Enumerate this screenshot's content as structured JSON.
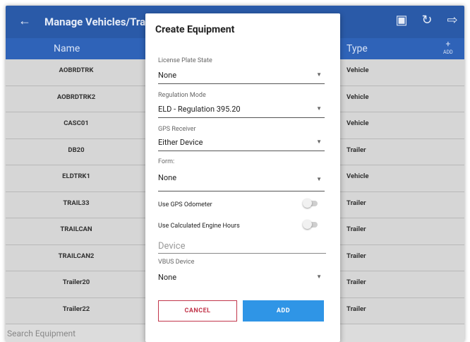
{
  "appbar": {
    "title": "Manage Vehicles/Trailers",
    "icons": [
      "back-arrow-icon",
      "report-icon",
      "refresh-icon",
      "exit-icon"
    ]
  },
  "table": {
    "col_name": "Name",
    "col_type": "Type",
    "add_label": "ADD",
    "rows": [
      {
        "name": "AOBRDTRK",
        "type": "Vehicle"
      },
      {
        "name": "AOBRDTRK2",
        "type": "Vehicle"
      },
      {
        "name": "CASC01",
        "type": "Vehicle"
      },
      {
        "name": "DB20",
        "type": "Trailer"
      },
      {
        "name": "ELDTRK1",
        "type": "Vehicle"
      },
      {
        "name": "TRAIL33",
        "type": "Trailer"
      },
      {
        "name": "TRAILCAN",
        "type": "Trailer"
      },
      {
        "name": "TRAILCAN2",
        "type": "Trailer"
      },
      {
        "name": "Trailer20",
        "type": "Trailer"
      },
      {
        "name": "Trailer22",
        "type": "Trailer"
      }
    ]
  },
  "search_placeholder": "Search Equipment",
  "dialog": {
    "title": "Create Equipment",
    "license_plate_state_label": "License Plate State",
    "license_plate_state_value": "None",
    "regulation_mode_label": "Regulation Mode",
    "regulation_mode_value": "ELD - Regulation 395.20",
    "gps_receiver_label": "GPS Receiver",
    "gps_receiver_value": "Either Device",
    "form_label": "Form:",
    "form_value": "None",
    "use_gps_odometer_label": "Use GPS Odometer",
    "use_gps_odometer_on": false,
    "use_calc_engine_hours_label": "Use Calculated Engine Hours",
    "use_calc_engine_hours_on": false,
    "device_placeholder": "Device",
    "vbus_device_label": "VBUS Device",
    "vbus_device_value": "None",
    "cancel_label": "CANCEL",
    "add_label": "ADD"
  },
  "colors": {
    "appbar": "#2a5aa8",
    "header_row": "#2f63b8",
    "cancel": "#c2364b",
    "add": "#2f95e6"
  }
}
